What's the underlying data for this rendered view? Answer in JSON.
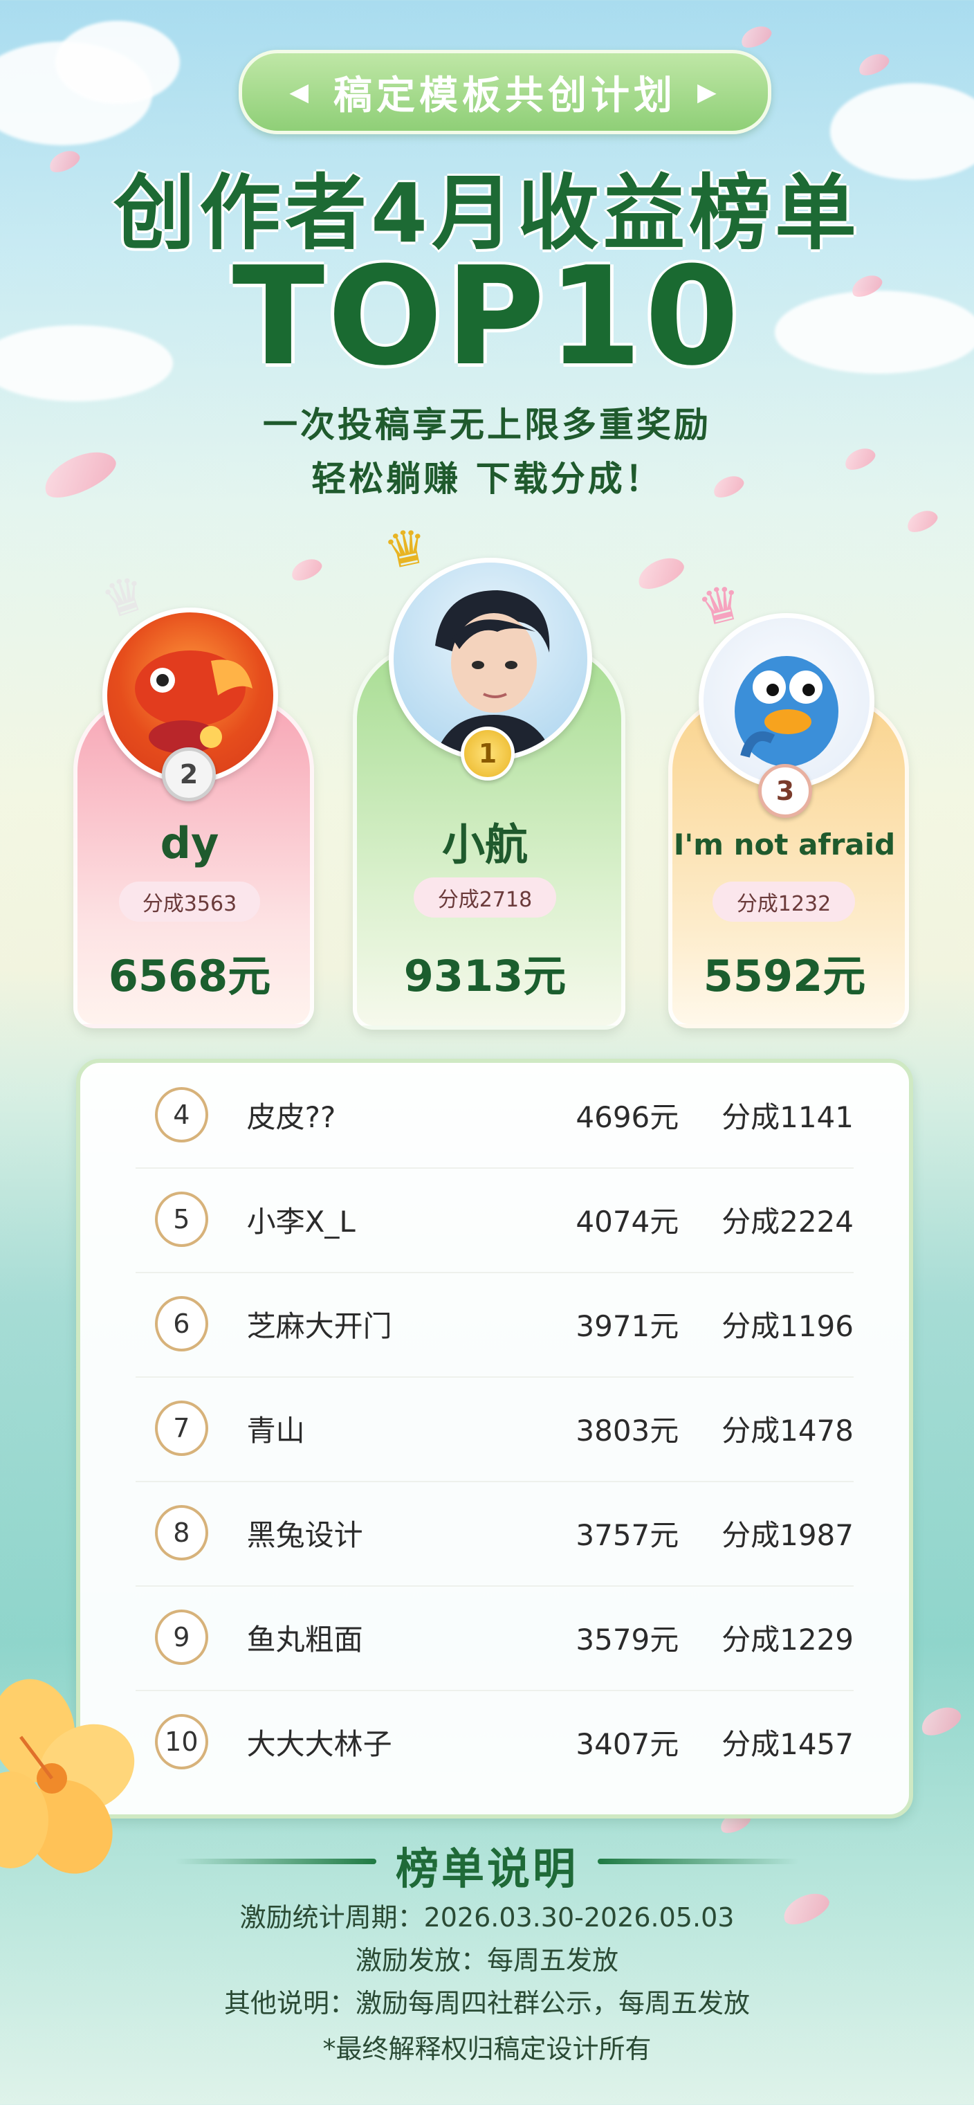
{
  "header": {
    "pill_label": "稿定模板共创计划",
    "title_line1": "创作者4月收益榜单",
    "title_line2": "TOP10",
    "subtitle_line1": "一次投稿享无上限多重奖励",
    "subtitle_line2": "轻松躺赚 下载分成！"
  },
  "podium": [
    {
      "rank": "2",
      "name": "dy",
      "share": "分成3563",
      "amount": "6568元",
      "color": "#f7a6b5"
    },
    {
      "rank": "1",
      "name": "小航",
      "share": "分成2718",
      "amount": "9313元",
      "color": "#a8dd93"
    },
    {
      "rank": "3",
      "name": "I'm not afraid",
      "share": "分成1232",
      "amount": "5592元",
      "color": "#fad48f"
    }
  ],
  "ranking": [
    {
      "rank": "4",
      "name": "皮皮??",
      "amount": "4696元",
      "share": "分成1141"
    },
    {
      "rank": "5",
      "name": "小李X_L",
      "amount": "4074元",
      "share": "分成2224"
    },
    {
      "rank": "6",
      "name": "芝麻大开门",
      "amount": "3971元",
      "share": "分成1196"
    },
    {
      "rank": "7",
      "name": "青山",
      "amount": "3803元",
      "share": "分成1478"
    },
    {
      "rank": "8",
      "name": "黑兔设计",
      "amount": "3757元",
      "share": "分成1987"
    },
    {
      "rank": "9",
      "name": "鱼丸粗面",
      "amount": "3579元",
      "share": "分成1229"
    },
    {
      "rank": "10",
      "name": "大大大林子",
      "amount": "3407元",
      "share": "分成1457"
    }
  ],
  "notes": {
    "title": "榜单说明",
    "line1": "激励统计周期：2026.03.30-2026.05.03",
    "line2": "激励发放：每周五发放",
    "line3": "其他说明：激励每周四社群公示，每周五发放",
    "line4": "*最终解释权归稿定设计所有"
  },
  "icons": {
    "crown": "crown-icon",
    "flower": "hibiscus-icon",
    "petal": "petal-icon"
  }
}
